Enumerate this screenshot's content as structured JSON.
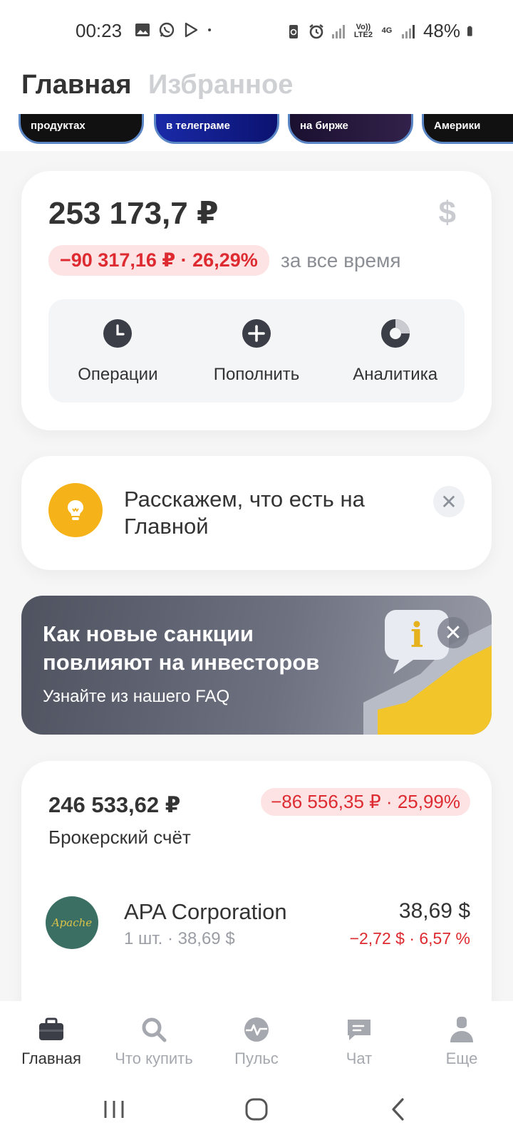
{
  "status_bar": {
    "time": "00:23",
    "battery": "48%",
    "network_volte": "Vo)) LTE2",
    "network_4g": "4G",
    "icons": [
      "gallery-icon",
      "whatsapp-icon",
      "play-store-icon",
      "dot-icon",
      "battery-saver-icon",
      "alarm-icon",
      "signal-icon",
      "signal-icon",
      "battery-icon"
    ]
  },
  "header": {
    "tab_main": "Главная",
    "tab_favorites": "Избранное"
  },
  "stories": [
    {
      "label": "продуктах"
    },
    {
      "label": "в телеграме"
    },
    {
      "label": "на бирже"
    },
    {
      "label": "Америки"
    }
  ],
  "balance": {
    "amount": "253 173,7 ₽",
    "currency_symbol": "$",
    "change": "−90 317,16 ₽ · 26,29%",
    "period": "за все время",
    "actions": [
      {
        "label": "Операции",
        "icon": "clock-icon"
      },
      {
        "label": "Пополнить",
        "icon": "plus-icon"
      },
      {
        "label": "Аналитика",
        "icon": "donut-chart-icon"
      }
    ]
  },
  "hint": {
    "text": "Расскажем, что есть на Главной",
    "icon": "lightbulb-icon"
  },
  "promo": {
    "title": "Как новые санкции повлияют на инвесторов",
    "subtitle": "Узнайте из нашего FAQ",
    "icon": "info-bubble-icon"
  },
  "broker": {
    "amount": "246 533,62 ₽",
    "change": "−86 556,35 ₽ · 25,99%",
    "label": "Брокерский счёт",
    "assets": [
      {
        "logo_text": "Apache",
        "name": "APA Corporation",
        "qty": "1 шт. · 38,69 $",
        "price": "38,69 $",
        "change": "−2,72 $ · 6,57 %"
      }
    ]
  },
  "bottom_nav": [
    {
      "label": "Главная",
      "icon": "briefcase-icon",
      "active": true
    },
    {
      "label": "Что купить",
      "icon": "search-icon",
      "active": false
    },
    {
      "label": "Пульс",
      "icon": "pulse-icon",
      "active": false
    },
    {
      "label": "Чат",
      "icon": "chat-icon",
      "active": false
    },
    {
      "label": "Еще",
      "icon": "profile-icon",
      "active": false
    }
  ],
  "colors": {
    "accent_yellow": "#f6b319",
    "negative_red": "#dd2b31",
    "negative_bg": "#fde3e4"
  }
}
